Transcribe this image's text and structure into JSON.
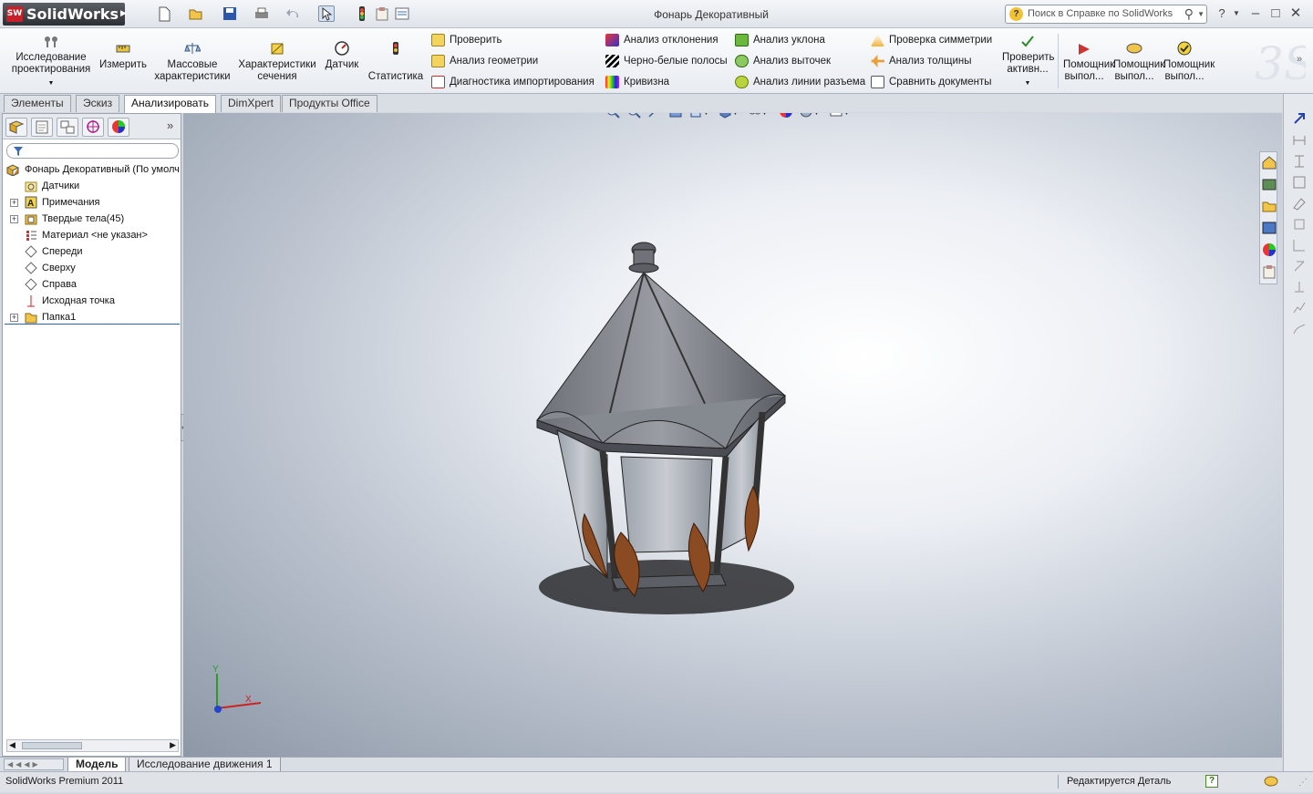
{
  "app": {
    "name": "SolidWorks",
    "logo_badge": "SW"
  },
  "window": {
    "title": "Фонарь Декоративный",
    "search_placeholder": "Поиск в Справке по SolidWorks",
    "help_label": "?"
  },
  "ribbon": {
    "large_buttons": [
      {
        "label": "Исследование проектирования",
        "icon": "design-study-icon"
      },
      {
        "label": "Измерить",
        "icon": "measure-icon"
      },
      {
        "label": "Массовые характеристики",
        "icon": "mass-properties-icon"
      },
      {
        "label": "Характеристики сечения",
        "icon": "section-properties-icon"
      },
      {
        "label": "Датчик",
        "icon": "sensor-icon"
      },
      {
        "label": "Статистика",
        "icon": "statistics-icon"
      }
    ],
    "group1": [
      "Проверить",
      "Анализ геометрии",
      "Диагностика импортирования"
    ],
    "group2": [
      "Анализ отклонения",
      "Черно-белые полосы",
      "Кривизна"
    ],
    "group3": [
      "Анализ уклона",
      "Анализ выточек",
      "Анализ линии разъема"
    ],
    "group4": [
      "Проверка симметрии",
      "Анализ толщины",
      "Сравнить документы"
    ],
    "check_active": "Проверить активн...",
    "wizards": [
      "Помощник выпол...",
      "Помощник выпол...",
      "Помощник выпол..."
    ]
  },
  "tabs": [
    "Элементы",
    "Эскиз",
    "Анализировать",
    "DimXpert",
    "Продукты Office"
  ],
  "active_tab": "Анализировать",
  "tree": {
    "root": "Фонарь Декоративный  (По умолч",
    "items": [
      {
        "label": "Датчики",
        "icon": "sensor-folder-icon",
        "expandable": false
      },
      {
        "label": "Примечания",
        "icon": "annotations-icon",
        "expandable": true
      },
      {
        "label": "Твердые тела(45)",
        "icon": "solid-bodies-icon",
        "expandable": true
      },
      {
        "label": "Материал <не указан>",
        "icon": "material-icon",
        "expandable": false
      },
      {
        "label": "Спереди",
        "icon": "plane-icon",
        "expandable": false
      },
      {
        "label": "Сверху",
        "icon": "plane-icon",
        "expandable": false
      },
      {
        "label": "Справа",
        "icon": "plane-icon",
        "expandable": false
      },
      {
        "label": "Исходная точка",
        "icon": "origin-icon",
        "expandable": false
      },
      {
        "label": "Папка1",
        "icon": "folder-icon",
        "expandable": true
      }
    ]
  },
  "viewport": {
    "axis_x": "X",
    "axis_y": "Y"
  },
  "bottom_tabs": [
    "Модель",
    "Исследование движения 1"
  ],
  "status": {
    "left": "SolidWorks Premium 2011",
    "right": "Редактируется Деталь",
    "help": "?"
  },
  "colors": {
    "brand_red": "#c8202a",
    "bronze": "#8a4a22",
    "frame": "#555a60"
  }
}
